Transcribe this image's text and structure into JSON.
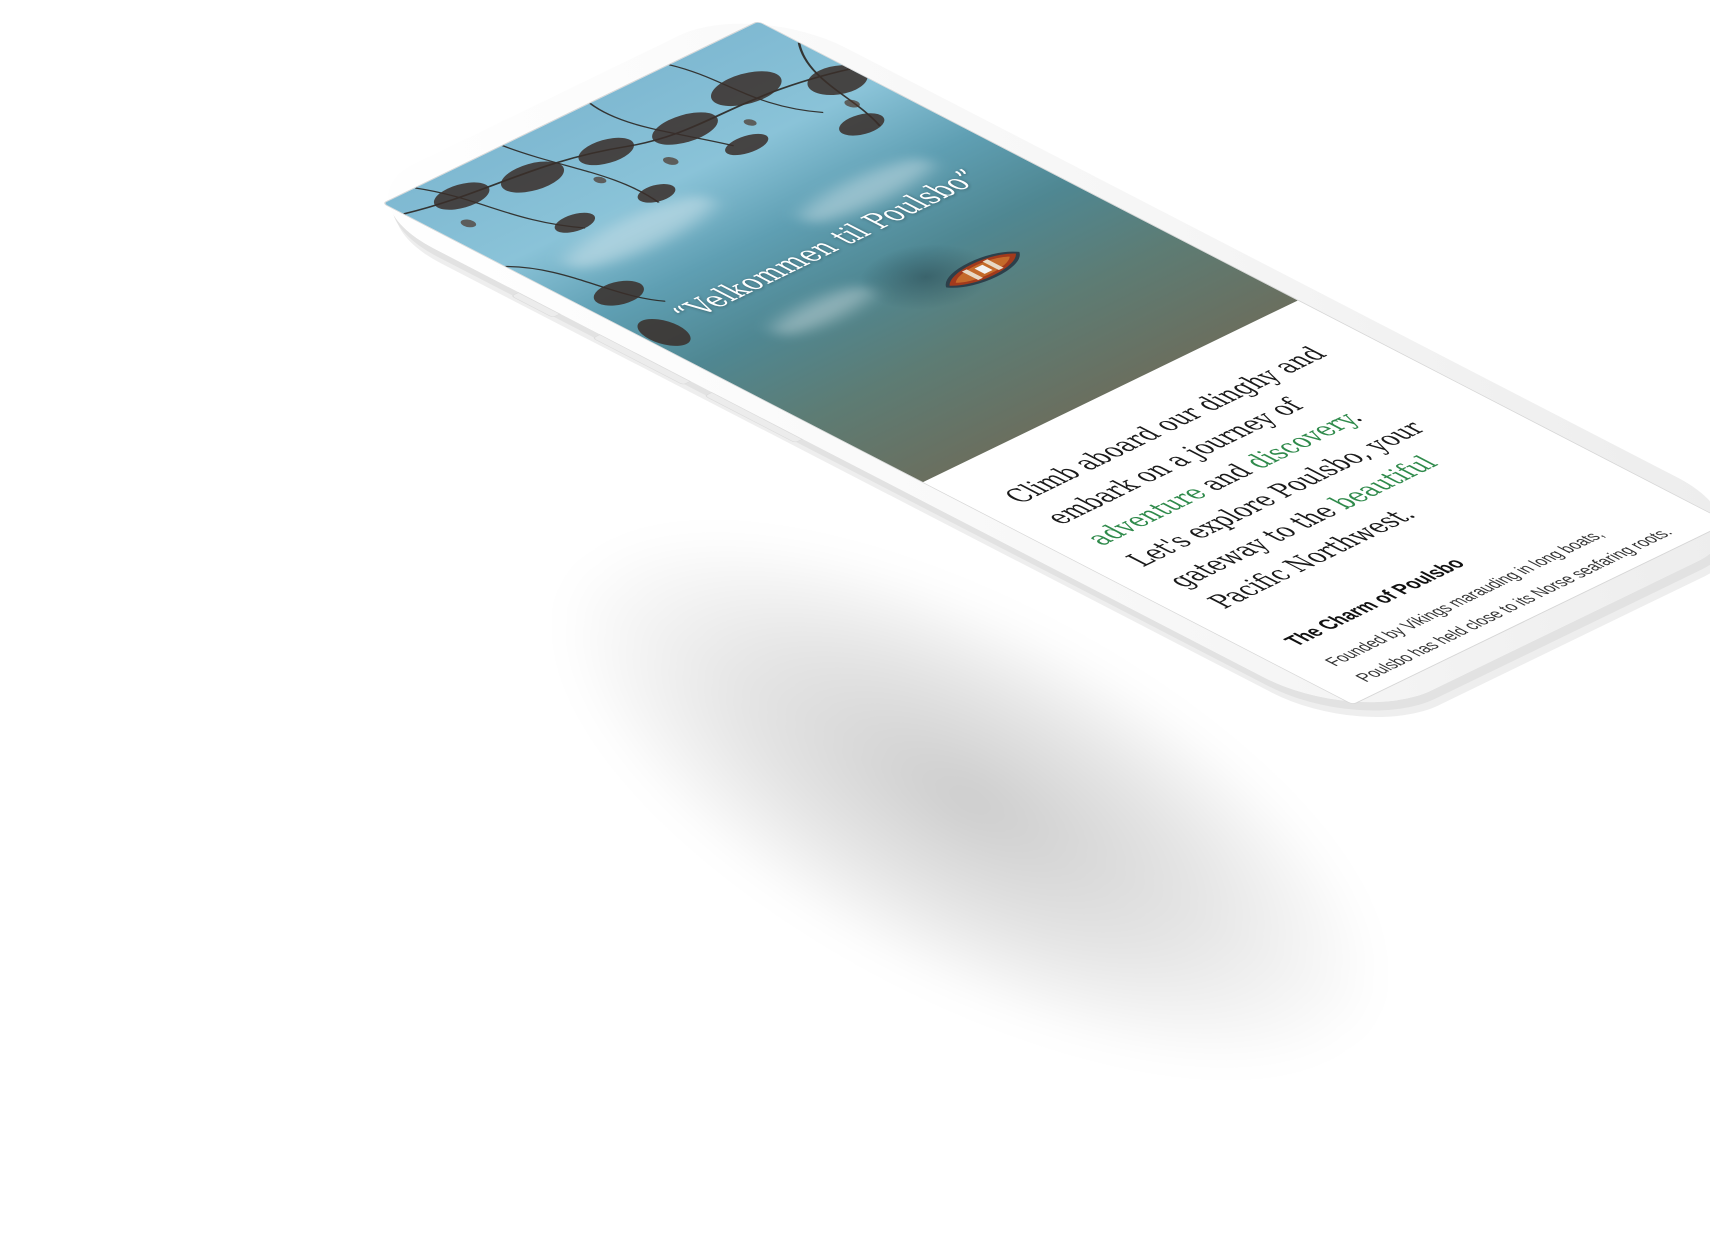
{
  "hero": {
    "title": "“Velkommen til Poulsbo”"
  },
  "intro": {
    "part1": "Climb aboard our dinghy and embark on a journey of ",
    "word_adventure": "adventure",
    "part2": " and ",
    "word_discovery": "discovery",
    "part3": ". Let's explore Poulsbo, your gateway to the ",
    "word_beautiful": "beautiful",
    "part4": " Pacific Northwest."
  },
  "section": {
    "heading": "The Charm of Poulsbo",
    "body": "Founded by Vikings marauding in long boats, Poulsbo has held close to its Norse seafaring roots. The charming downtown, nestled on the waters of the Puget Sound, features charming"
  },
  "colors": {
    "accent_green": "#2f8a4b",
    "text_dark": "#1a1a1a"
  },
  "icons": {
    "hero_image": "rowboat-on-water-photo"
  }
}
